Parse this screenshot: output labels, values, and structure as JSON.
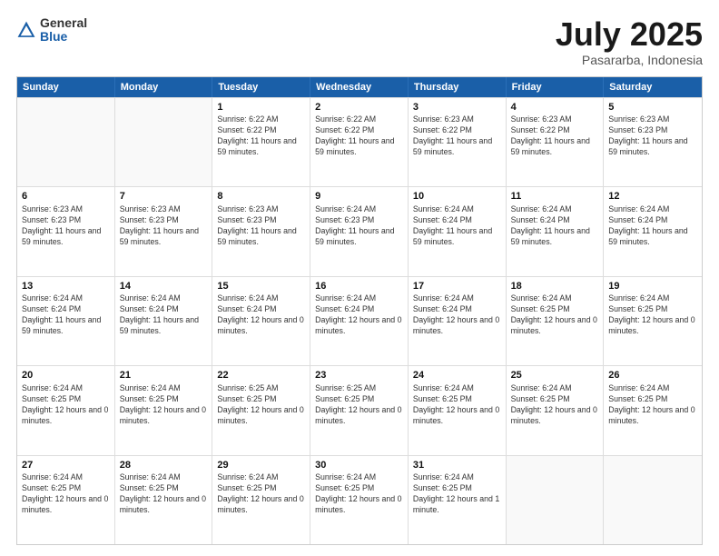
{
  "logo": {
    "general": "General",
    "blue": "Blue"
  },
  "header": {
    "month": "July 2025",
    "location": "Pasararba, Indonesia"
  },
  "weekdays": [
    "Sunday",
    "Monday",
    "Tuesday",
    "Wednesday",
    "Thursday",
    "Friday",
    "Saturday"
  ],
  "rows": [
    [
      {
        "day": "",
        "empty": true
      },
      {
        "day": "",
        "empty": true
      },
      {
        "day": "1",
        "sunrise": "Sunrise: 6:22 AM",
        "sunset": "Sunset: 6:22 PM",
        "daylight": "Daylight: 11 hours and 59 minutes."
      },
      {
        "day": "2",
        "sunrise": "Sunrise: 6:22 AM",
        "sunset": "Sunset: 6:22 PM",
        "daylight": "Daylight: 11 hours and 59 minutes."
      },
      {
        "day": "3",
        "sunrise": "Sunrise: 6:23 AM",
        "sunset": "Sunset: 6:22 PM",
        "daylight": "Daylight: 11 hours and 59 minutes."
      },
      {
        "day": "4",
        "sunrise": "Sunrise: 6:23 AM",
        "sunset": "Sunset: 6:22 PM",
        "daylight": "Daylight: 11 hours and 59 minutes."
      },
      {
        "day": "5",
        "sunrise": "Sunrise: 6:23 AM",
        "sunset": "Sunset: 6:23 PM",
        "daylight": "Daylight: 11 hours and 59 minutes."
      }
    ],
    [
      {
        "day": "6",
        "sunrise": "Sunrise: 6:23 AM",
        "sunset": "Sunset: 6:23 PM",
        "daylight": "Daylight: 11 hours and 59 minutes."
      },
      {
        "day": "7",
        "sunrise": "Sunrise: 6:23 AM",
        "sunset": "Sunset: 6:23 PM",
        "daylight": "Daylight: 11 hours and 59 minutes."
      },
      {
        "day": "8",
        "sunrise": "Sunrise: 6:23 AM",
        "sunset": "Sunset: 6:23 PM",
        "daylight": "Daylight: 11 hours and 59 minutes."
      },
      {
        "day": "9",
        "sunrise": "Sunrise: 6:24 AM",
        "sunset": "Sunset: 6:23 PM",
        "daylight": "Daylight: 11 hours and 59 minutes."
      },
      {
        "day": "10",
        "sunrise": "Sunrise: 6:24 AM",
        "sunset": "Sunset: 6:24 PM",
        "daylight": "Daylight: 11 hours and 59 minutes."
      },
      {
        "day": "11",
        "sunrise": "Sunrise: 6:24 AM",
        "sunset": "Sunset: 6:24 PM",
        "daylight": "Daylight: 11 hours and 59 minutes."
      },
      {
        "day": "12",
        "sunrise": "Sunrise: 6:24 AM",
        "sunset": "Sunset: 6:24 PM",
        "daylight": "Daylight: 11 hours and 59 minutes."
      }
    ],
    [
      {
        "day": "13",
        "sunrise": "Sunrise: 6:24 AM",
        "sunset": "Sunset: 6:24 PM",
        "daylight": "Daylight: 11 hours and 59 minutes."
      },
      {
        "day": "14",
        "sunrise": "Sunrise: 6:24 AM",
        "sunset": "Sunset: 6:24 PM",
        "daylight": "Daylight: 11 hours and 59 minutes."
      },
      {
        "day": "15",
        "sunrise": "Sunrise: 6:24 AM",
        "sunset": "Sunset: 6:24 PM",
        "daylight": "Daylight: 12 hours and 0 minutes."
      },
      {
        "day": "16",
        "sunrise": "Sunrise: 6:24 AM",
        "sunset": "Sunset: 6:24 PM",
        "daylight": "Daylight: 12 hours and 0 minutes."
      },
      {
        "day": "17",
        "sunrise": "Sunrise: 6:24 AM",
        "sunset": "Sunset: 6:24 PM",
        "daylight": "Daylight: 12 hours and 0 minutes."
      },
      {
        "day": "18",
        "sunrise": "Sunrise: 6:24 AM",
        "sunset": "Sunset: 6:25 PM",
        "daylight": "Daylight: 12 hours and 0 minutes."
      },
      {
        "day": "19",
        "sunrise": "Sunrise: 6:24 AM",
        "sunset": "Sunset: 6:25 PM",
        "daylight": "Daylight: 12 hours and 0 minutes."
      }
    ],
    [
      {
        "day": "20",
        "sunrise": "Sunrise: 6:24 AM",
        "sunset": "Sunset: 6:25 PM",
        "daylight": "Daylight: 12 hours and 0 minutes."
      },
      {
        "day": "21",
        "sunrise": "Sunrise: 6:24 AM",
        "sunset": "Sunset: 6:25 PM",
        "daylight": "Daylight: 12 hours and 0 minutes."
      },
      {
        "day": "22",
        "sunrise": "Sunrise: 6:25 AM",
        "sunset": "Sunset: 6:25 PM",
        "daylight": "Daylight: 12 hours and 0 minutes."
      },
      {
        "day": "23",
        "sunrise": "Sunrise: 6:25 AM",
        "sunset": "Sunset: 6:25 PM",
        "daylight": "Daylight: 12 hours and 0 minutes."
      },
      {
        "day": "24",
        "sunrise": "Sunrise: 6:24 AM",
        "sunset": "Sunset: 6:25 PM",
        "daylight": "Daylight: 12 hours and 0 minutes."
      },
      {
        "day": "25",
        "sunrise": "Sunrise: 6:24 AM",
        "sunset": "Sunset: 6:25 PM",
        "daylight": "Daylight: 12 hours and 0 minutes."
      },
      {
        "day": "26",
        "sunrise": "Sunrise: 6:24 AM",
        "sunset": "Sunset: 6:25 PM",
        "daylight": "Daylight: 12 hours and 0 minutes."
      }
    ],
    [
      {
        "day": "27",
        "sunrise": "Sunrise: 6:24 AM",
        "sunset": "Sunset: 6:25 PM",
        "daylight": "Daylight: 12 hours and 0 minutes."
      },
      {
        "day": "28",
        "sunrise": "Sunrise: 6:24 AM",
        "sunset": "Sunset: 6:25 PM",
        "daylight": "Daylight: 12 hours and 0 minutes."
      },
      {
        "day": "29",
        "sunrise": "Sunrise: 6:24 AM",
        "sunset": "Sunset: 6:25 PM",
        "daylight": "Daylight: 12 hours and 0 minutes."
      },
      {
        "day": "30",
        "sunrise": "Sunrise: 6:24 AM",
        "sunset": "Sunset: 6:25 PM",
        "daylight": "Daylight: 12 hours and 0 minutes."
      },
      {
        "day": "31",
        "sunrise": "Sunrise: 6:24 AM",
        "sunset": "Sunset: 6:25 PM",
        "daylight": "Daylight: 12 hours and 1 minute."
      },
      {
        "day": "",
        "empty": true
      },
      {
        "day": "",
        "empty": true
      }
    ]
  ]
}
